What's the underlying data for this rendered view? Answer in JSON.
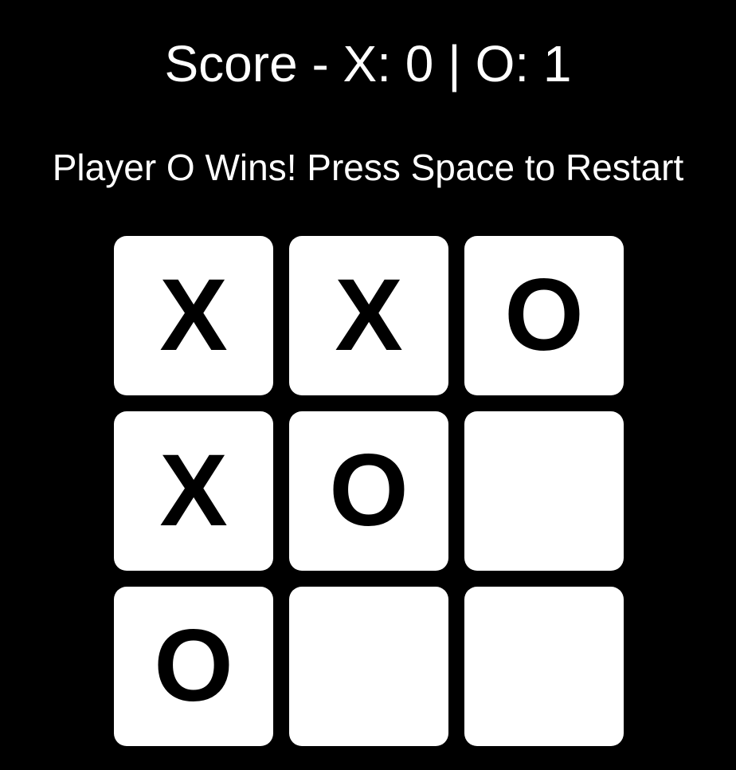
{
  "score": {
    "text": "Score - X: 0 | O: 1",
    "x": 0,
    "o": 1
  },
  "status": "Player O Wins! Press Space to Restart",
  "board": {
    "cells": [
      "X",
      "X",
      "O",
      "X",
      "O",
      "",
      "O",
      "",
      ""
    ]
  },
  "colors": {
    "background": "#000000",
    "cell": "#ffffff",
    "mark": "#000000",
    "text": "#ffffff"
  }
}
